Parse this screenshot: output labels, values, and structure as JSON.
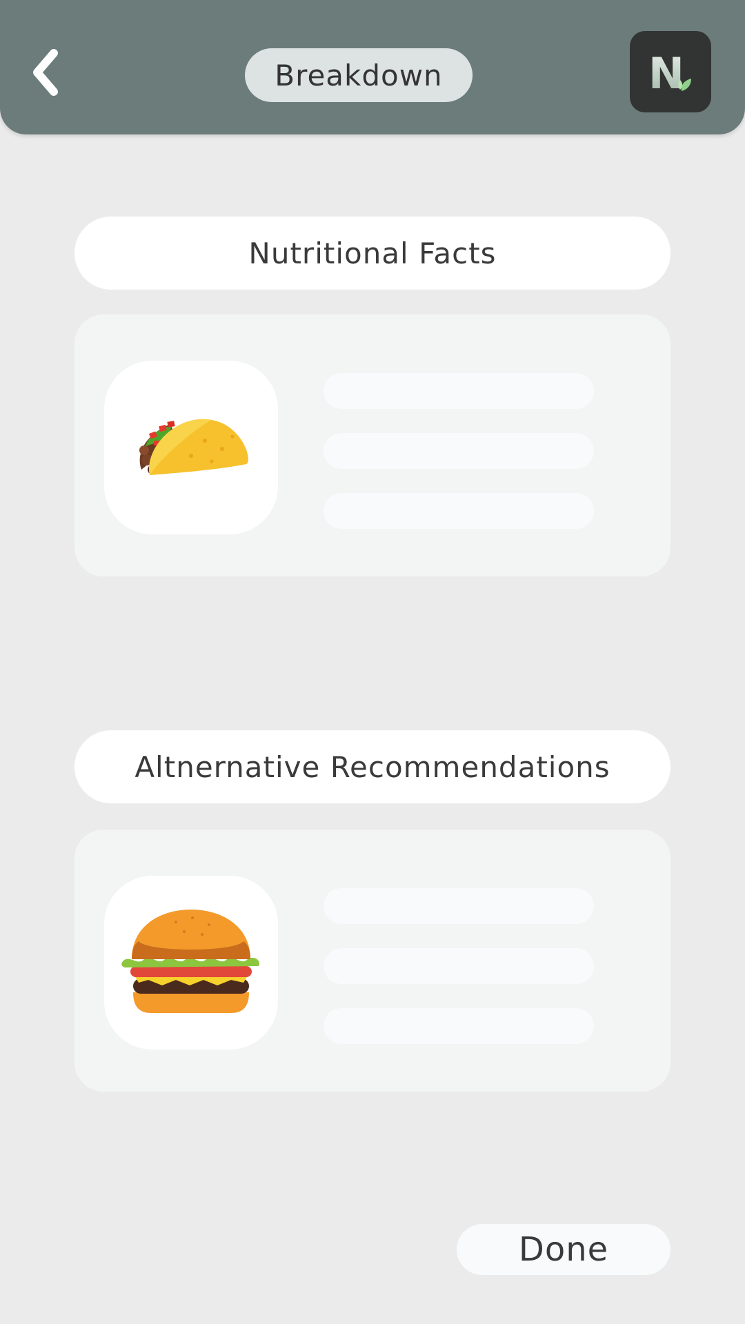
{
  "header": {
    "title": "Breakdown",
    "logo_letter": "N",
    "colors": {
      "bar": "#6b7c7b",
      "title_pill": "#dde3e3",
      "logo_bg": "#323333"
    }
  },
  "sections": [
    {
      "title": "Nutritional Facts",
      "item_icon": "taco-icon"
    },
    {
      "title": "Altnernative Recommendations",
      "item_icon": "hamburger-icon"
    }
  ],
  "footer": {
    "done_label": "Done"
  }
}
